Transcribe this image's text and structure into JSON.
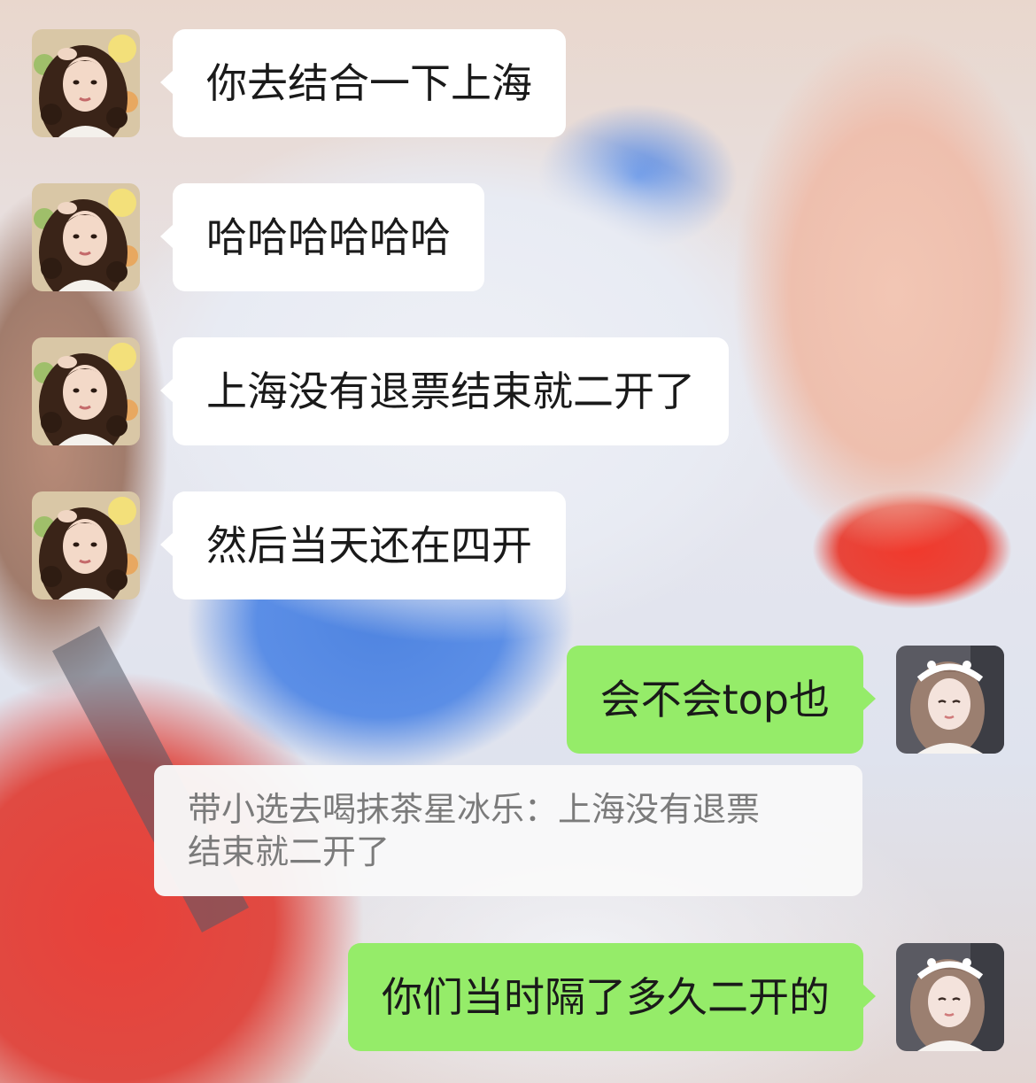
{
  "chat": {
    "messages": [
      {
        "direction": "incoming",
        "text": "你去结合一下上海",
        "avatar": "avatar-curly-hair"
      },
      {
        "direction": "incoming",
        "text": "哈哈哈哈哈哈",
        "avatar": "avatar-curly-hair"
      },
      {
        "direction": "incoming",
        "text": "上海没有退票结束就二开了",
        "avatar": "avatar-curly-hair"
      },
      {
        "direction": "incoming",
        "text": "然后当天还在四开",
        "avatar": "avatar-curly-hair"
      },
      {
        "direction": "outgoing",
        "text": "会不会top也",
        "avatar": "avatar-headband-girl"
      },
      {
        "direction": "outgoing",
        "text": "你们当时隔了多久二开的",
        "avatar": "avatar-headband-girl"
      }
    ],
    "quote": {
      "line1": "带小选去喝抹茶星冰乐：上海没有退票",
      "line2": "结束就二开了"
    },
    "colors": {
      "incoming_bubble": "#ffffff",
      "outgoing_bubble": "#95ec69",
      "quote_text": "#7b7b7b",
      "message_text": "#1a1a1a"
    }
  }
}
